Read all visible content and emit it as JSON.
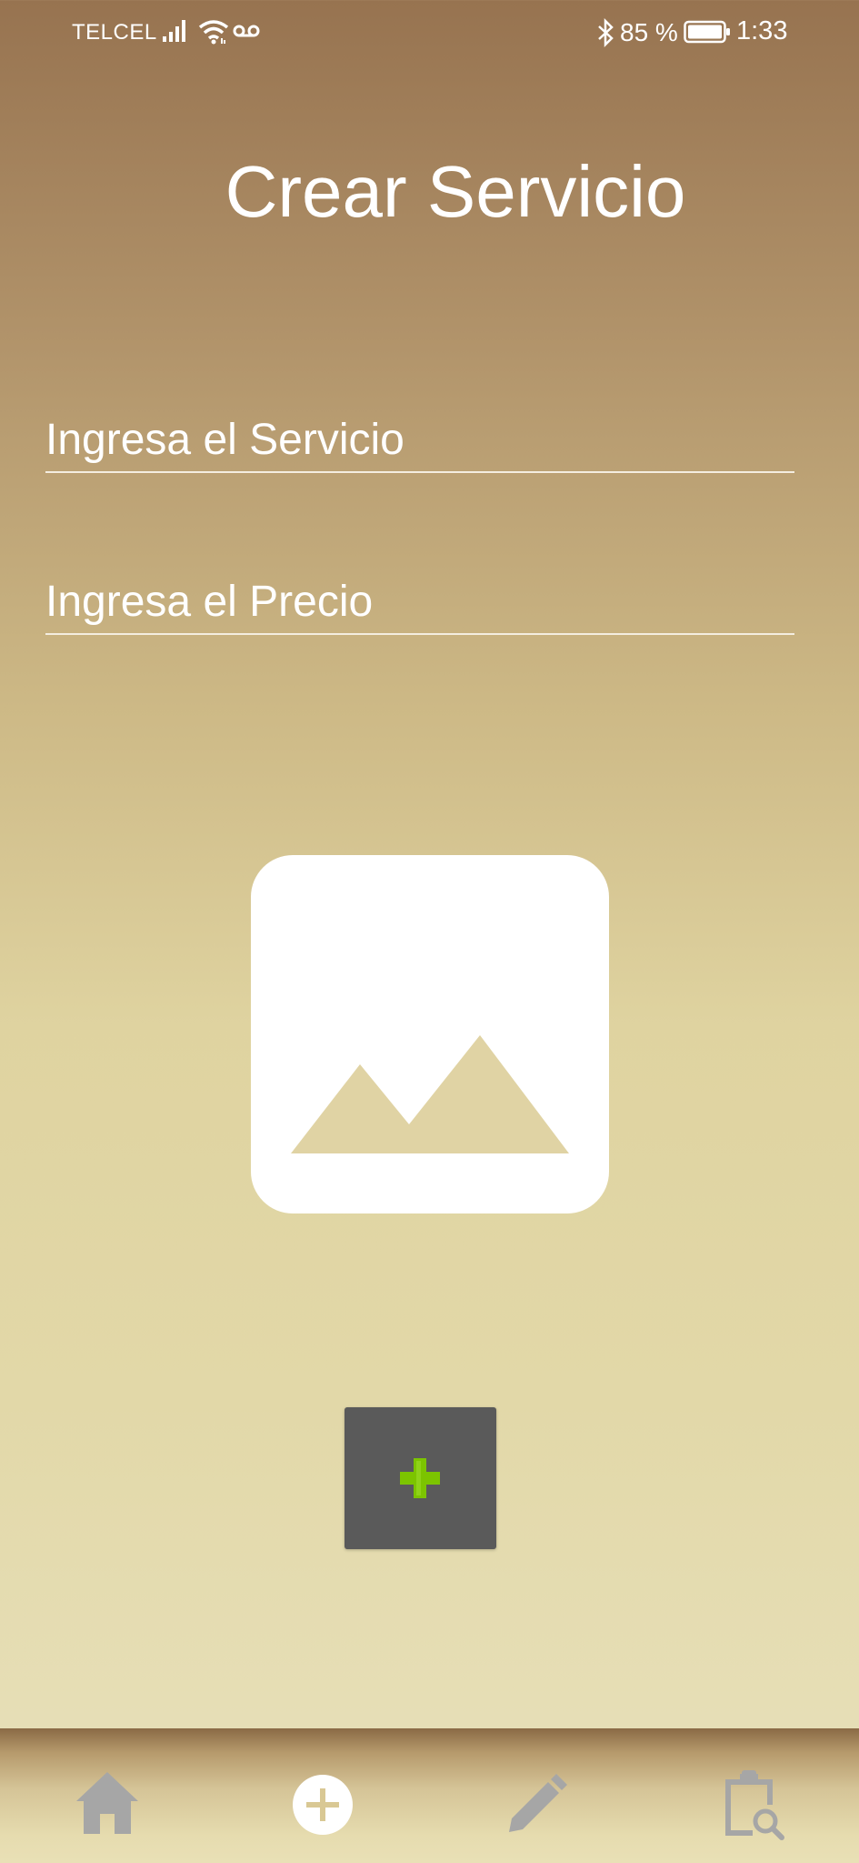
{
  "status_bar": {
    "carrier": "TELCEL",
    "battery": "85 %",
    "time": "1:33",
    "icons": [
      "signal-icon",
      "wifi-icon",
      "voicemail-icon",
      "bluetooth-icon",
      "battery-icon"
    ]
  },
  "page": {
    "title": "Crear Servicio"
  },
  "form": {
    "service_placeholder": "Ingresa el Servicio",
    "price_placeholder": "Ingresa el Precio",
    "image_icon": "image-placeholder-icon",
    "add_button_icon": "plus-icon"
  },
  "bottom_nav": {
    "items": [
      {
        "icon": "home-icon"
      },
      {
        "icon": "add-circle-icon",
        "selected": true
      },
      {
        "icon": "pencil-icon"
      },
      {
        "icon": "clipboard-search-icon"
      }
    ]
  },
  "colors": {
    "gradient_top": "#977350",
    "gradient_bottom": "#e8e1bc",
    "accent_green": "#7cc400",
    "button_bg": "#5a5a5a",
    "nav_icon": "#a6a6a6",
    "image_mountain": "#e0d3a4"
  }
}
